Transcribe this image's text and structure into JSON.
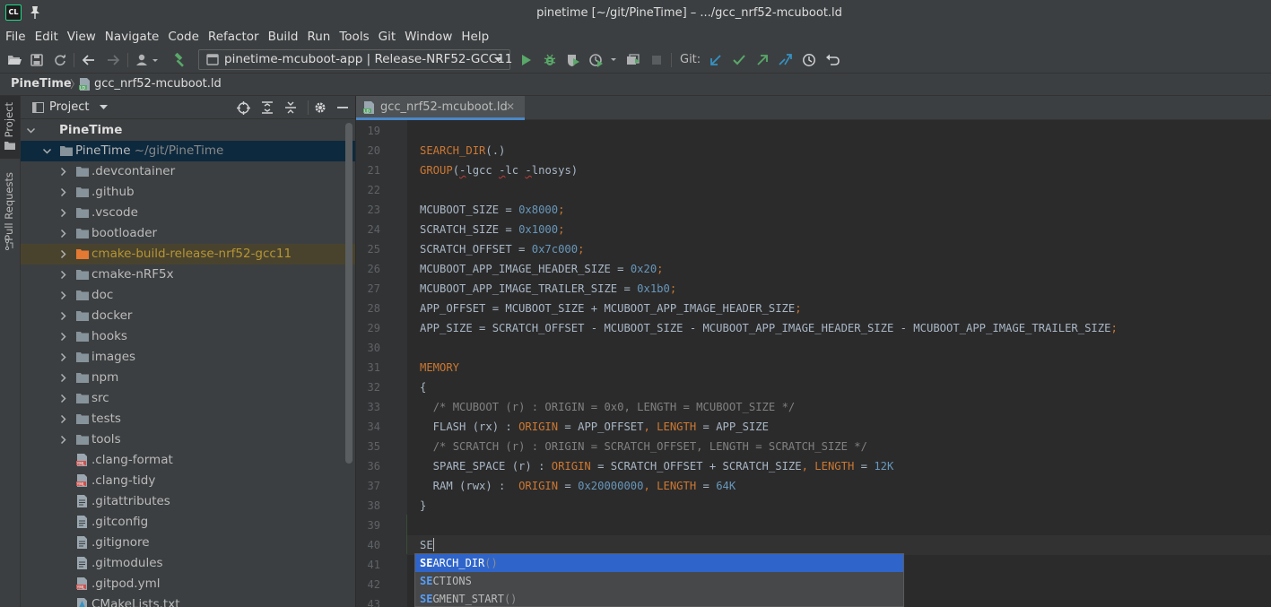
{
  "window": {
    "title": "pinetime [~/git/PineTime] – .../gcc_nrf52-mcuboot.ld",
    "app_logo": "CL"
  },
  "menu": [
    "File",
    "Edit",
    "View",
    "Navigate",
    "Code",
    "Refactor",
    "Build",
    "Run",
    "Tools",
    "Git",
    "Window",
    "Help"
  ],
  "toolbar": {
    "run_config": "pinetime-mcuboot-app | Release-NRF52-GCC11",
    "git_label": "Git:"
  },
  "breadcrumb": {
    "root": "PineTime",
    "file": "gcc_nrf52-mcuboot.ld"
  },
  "left_strip": {
    "project": "Project",
    "pull_requests": "Pull Requests"
  },
  "project_panel": {
    "title": "Project",
    "tree": [
      {
        "label": "PineTime",
        "hint": "",
        "type": "root",
        "depth": 0,
        "expanded": true,
        "style": "bold"
      },
      {
        "label": "PineTime",
        "hint": "~/git/PineTime",
        "type": "folder",
        "depth": 1,
        "expanded": true,
        "style": "selected"
      },
      {
        "label": ".devcontainer",
        "hint": "",
        "type": "folder",
        "depth": 2,
        "expanded": false,
        "style": ""
      },
      {
        "label": ".github",
        "hint": "",
        "type": "folder",
        "depth": 2,
        "expanded": false,
        "style": ""
      },
      {
        "label": ".vscode",
        "hint": "",
        "type": "folder",
        "depth": 2,
        "expanded": false,
        "style": ""
      },
      {
        "label": "bootloader",
        "hint": "",
        "type": "folder",
        "depth": 2,
        "expanded": false,
        "style": ""
      },
      {
        "label": "cmake-build-release-nrf52-gcc11",
        "hint": "",
        "type": "folder-excluded",
        "depth": 2,
        "expanded": false,
        "style": "excluded"
      },
      {
        "label": "cmake-nRF5x",
        "hint": "",
        "type": "folder",
        "depth": 2,
        "expanded": false,
        "style": ""
      },
      {
        "label": "doc",
        "hint": "",
        "type": "folder",
        "depth": 2,
        "expanded": false,
        "style": ""
      },
      {
        "label": "docker",
        "hint": "",
        "type": "folder",
        "depth": 2,
        "expanded": false,
        "style": ""
      },
      {
        "label": "hooks",
        "hint": "",
        "type": "folder",
        "depth": 2,
        "expanded": false,
        "style": ""
      },
      {
        "label": "images",
        "hint": "",
        "type": "folder",
        "depth": 2,
        "expanded": false,
        "style": ""
      },
      {
        "label": "npm",
        "hint": "",
        "type": "folder",
        "depth": 2,
        "expanded": false,
        "style": ""
      },
      {
        "label": "src",
        "hint": "",
        "type": "folder",
        "depth": 2,
        "expanded": false,
        "style": ""
      },
      {
        "label": "tests",
        "hint": "",
        "type": "folder",
        "depth": 2,
        "expanded": false,
        "style": ""
      },
      {
        "label": "tools",
        "hint": "",
        "type": "folder",
        "depth": 2,
        "expanded": false,
        "style": ""
      },
      {
        "label": ".clang-format",
        "hint": "",
        "type": "file-yml",
        "depth": 2,
        "style": ""
      },
      {
        "label": ".clang-tidy",
        "hint": "",
        "type": "file-yml",
        "depth": 2,
        "style": ""
      },
      {
        "label": ".gitattributes",
        "hint": "",
        "type": "file",
        "depth": 2,
        "style": ""
      },
      {
        "label": ".gitconfig",
        "hint": "",
        "type": "file",
        "depth": 2,
        "style": ""
      },
      {
        "label": ".gitignore",
        "hint": "",
        "type": "file",
        "depth": 2,
        "style": ""
      },
      {
        "label": ".gitmodules",
        "hint": "",
        "type": "file",
        "depth": 2,
        "style": ""
      },
      {
        "label": ".gitpod.yml",
        "hint": "",
        "type": "file-yml",
        "depth": 2,
        "style": ""
      },
      {
        "label": "CMakeLists.txt",
        "hint": "",
        "type": "file-cmake",
        "depth": 2,
        "style": ""
      }
    ]
  },
  "editor": {
    "tab_label": "gcc_nrf52-mcuboot.ld",
    "current_line": 40,
    "lines": [
      {
        "n": "19",
        "html": ""
      },
      {
        "n": "20",
        "html": "<span class='kw'>SEARCH_DIR</span>(.)"
      },
      {
        "n": "21",
        "html": "<span class='kw'>GROUP</span>(<span class='err'>-</span>lgcc <span class='err'>-</span>lc <span class='err'>-</span>lnosys)"
      },
      {
        "n": "22",
        "html": ""
      },
      {
        "n": "23",
        "html": "MCUBOOT_SIZE = <span class='num'>0x8000</span><span class='kw'>;</span>"
      },
      {
        "n": "24",
        "html": "SCRATCH_SIZE = <span class='num'>0x1000</span><span class='kw'>;</span>"
      },
      {
        "n": "25",
        "html": "SCRATCH_OFFSET = <span class='num'>0x7c000</span><span class='kw'>;</span>"
      },
      {
        "n": "26",
        "html": "MCUBOOT_APP_IMAGE_HEADER_SIZE = <span class='num'>0x20</span><span class='kw'>;</span>"
      },
      {
        "n": "27",
        "html": "MCUBOOT_APP_IMAGE_TRAILER_SIZE = <span class='num'>0x1b0</span><span class='kw'>;</span>"
      },
      {
        "n": "28",
        "html": "APP_OFFSET = MCUBOOT_SIZE + MCUBOOT_APP_IMAGE_HEADER_SIZE<span class='kw'>;</span>"
      },
      {
        "n": "29",
        "html": "APP_SIZE = SCRATCH_OFFSET - MCUBOOT_SIZE - MCUBOOT_APP_IMAGE_HEADER_SIZE - MCUBOOT_APP_IMAGE_TRAILER_SIZE<span class='kw'>;</span>"
      },
      {
        "n": "30",
        "html": ""
      },
      {
        "n": "31",
        "html": "<span class='kw'>MEMORY</span>"
      },
      {
        "n": "32",
        "html": "{"
      },
      {
        "n": "33",
        "html": "  <span class='cmt'>/* MCUBOOT (r) : ORIGIN = 0x0, LENGTH = MCUBOOT_SIZE */</span>"
      },
      {
        "n": "34",
        "html": "  FLASH (rx) : <span class='kw'>ORIGIN</span> = APP_OFFSET<span class='kw'>,</span> <span class='kw'>LENGTH</span> = APP_SIZE"
      },
      {
        "n": "35",
        "html": "  <span class='cmt'>/* SCRATCH (r) : ORIGIN = SCRATCH_OFFSET, LENGTH = SCRATCH_SIZE */</span>"
      },
      {
        "n": "36",
        "html": "  SPARE_SPACE (r) : <span class='kw'>ORIGIN</span> = SCRATCH_OFFSET + SCRATCH_SIZE<span class='kw'>,</span> <span class='kw'>LENGTH</span> = <span class='num'>12K</span>"
      },
      {
        "n": "37",
        "html": "  RAM (rwx) :  <span class='kw'>ORIGIN</span> = <span class='num'>0x20000000</span><span class='kw'>,</span> <span class='kw'>LENGTH</span> = <span class='num'>64K</span>"
      },
      {
        "n": "38",
        "html": "}"
      },
      {
        "n": "39",
        "html": ""
      },
      {
        "n": "40",
        "html": "SE<span class='caret'></span>"
      },
      {
        "n": "41",
        "html": ""
      },
      {
        "n": "42",
        "html": ""
      },
      {
        "n": "43",
        "html": ""
      }
    ]
  },
  "completion": {
    "typed": "SE",
    "items": [
      {
        "rest": "ARCH_DIR",
        "suffix": "()",
        "selected": true
      },
      {
        "rest": "CTIONS",
        "suffix": "",
        "selected": false
      },
      {
        "rest": "GMENT_START",
        "suffix": "()",
        "selected": false
      }
    ]
  },
  "colors": {
    "accent": "#4a88c7",
    "keyword": "#cc7832",
    "number": "#6897bb",
    "comment": "#808080",
    "selection": "#2f65ca",
    "excluded_folder": "#b59535"
  }
}
